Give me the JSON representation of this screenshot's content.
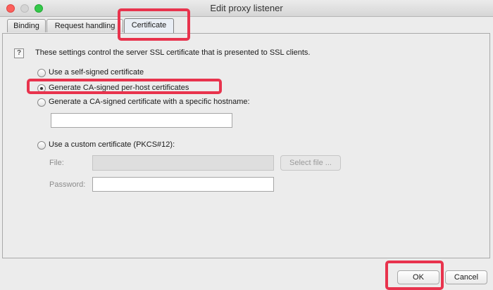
{
  "window": {
    "title": "Edit proxy listener"
  },
  "tabs": [
    {
      "label": "Binding"
    },
    {
      "label": "Request handling"
    },
    {
      "label": "Certificate"
    }
  ],
  "intro_text": "These settings control the server SSL certificate that is presented to SSL clients.",
  "options": [
    {
      "label": "Use a self-signed certificate",
      "checked": false
    },
    {
      "label": "Generate CA-signed per-host certificates",
      "checked": true
    },
    {
      "label": "Generate a CA-signed certificate with a specific hostname:",
      "checked": false
    },
    {
      "label": "Use a custom certificate (PKCS#12):",
      "checked": false
    }
  ],
  "hostname_value": "",
  "custom_cert": {
    "file_label": "File:",
    "file_value": "",
    "select_file_label": "Select file ...",
    "password_label": "Password:",
    "password_value": ""
  },
  "buttons": {
    "ok_label": "OK",
    "cancel_label": "Cancel"
  },
  "colors": {
    "highlight": "#e8334d"
  }
}
